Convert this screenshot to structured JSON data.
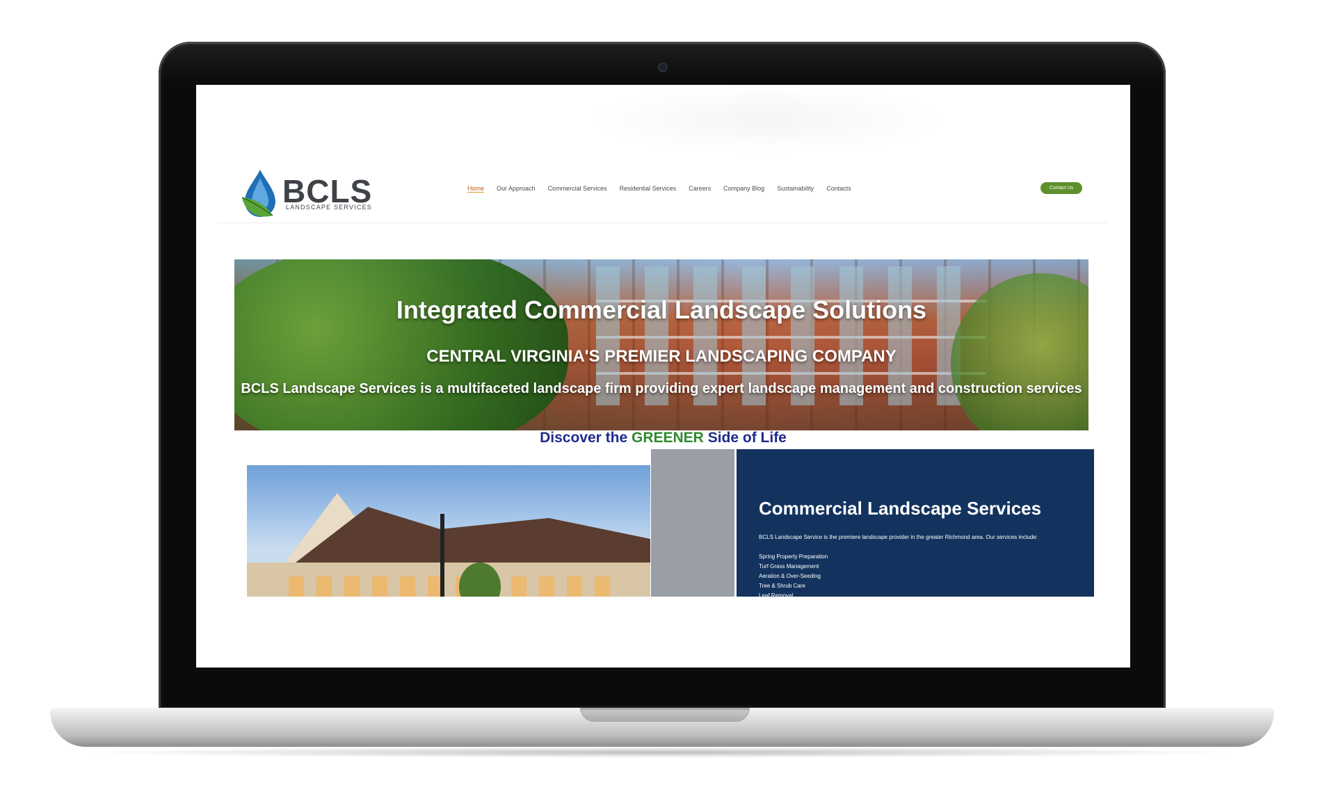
{
  "site": {
    "logo": {
      "name": "BCLS",
      "tagline": "LANDSCAPE SERVICES"
    },
    "nav": [
      "Home",
      "Our Approach",
      "Commercial Services",
      "Residential Services",
      "Careers",
      "Company Blog",
      "Sustainability",
      "Contacts"
    ],
    "nav_active": "Home",
    "contact_button": "Contact Us",
    "hero": {
      "title": "Integrated Commercial Landscape Solutions",
      "subtitle": "CENTRAL VIRGINIA'S PREMIER LANDSCAPING COMPANY",
      "description": "BCLS Landscape Services is a multifaceted landscape firm providing expert landscape management and construction services"
    },
    "tagline": {
      "before": "Discover the ",
      "highlight": "GREENER",
      "after": " Side of Life"
    },
    "services_panel": {
      "title": "Commercial Landscape Services",
      "intro": "BCLS Landscape Service is the premiere landscape provider in the greater Richmond area. Our services include:",
      "items": [
        "Spring Property Preparation",
        "Turf Grass Management",
        "Aeration & Over-Seeding",
        "Tree & Shrub Care",
        "Leaf Removal"
      ]
    }
  },
  "colors": {
    "brand_green": "#5e8f2c",
    "nav_active": "#b85c1a",
    "tagline_blue": "#1f2a8c",
    "tagline_green": "#2e8b2e",
    "panel_blue": "#13335e",
    "panel_grey": "#9a9ea6"
  }
}
